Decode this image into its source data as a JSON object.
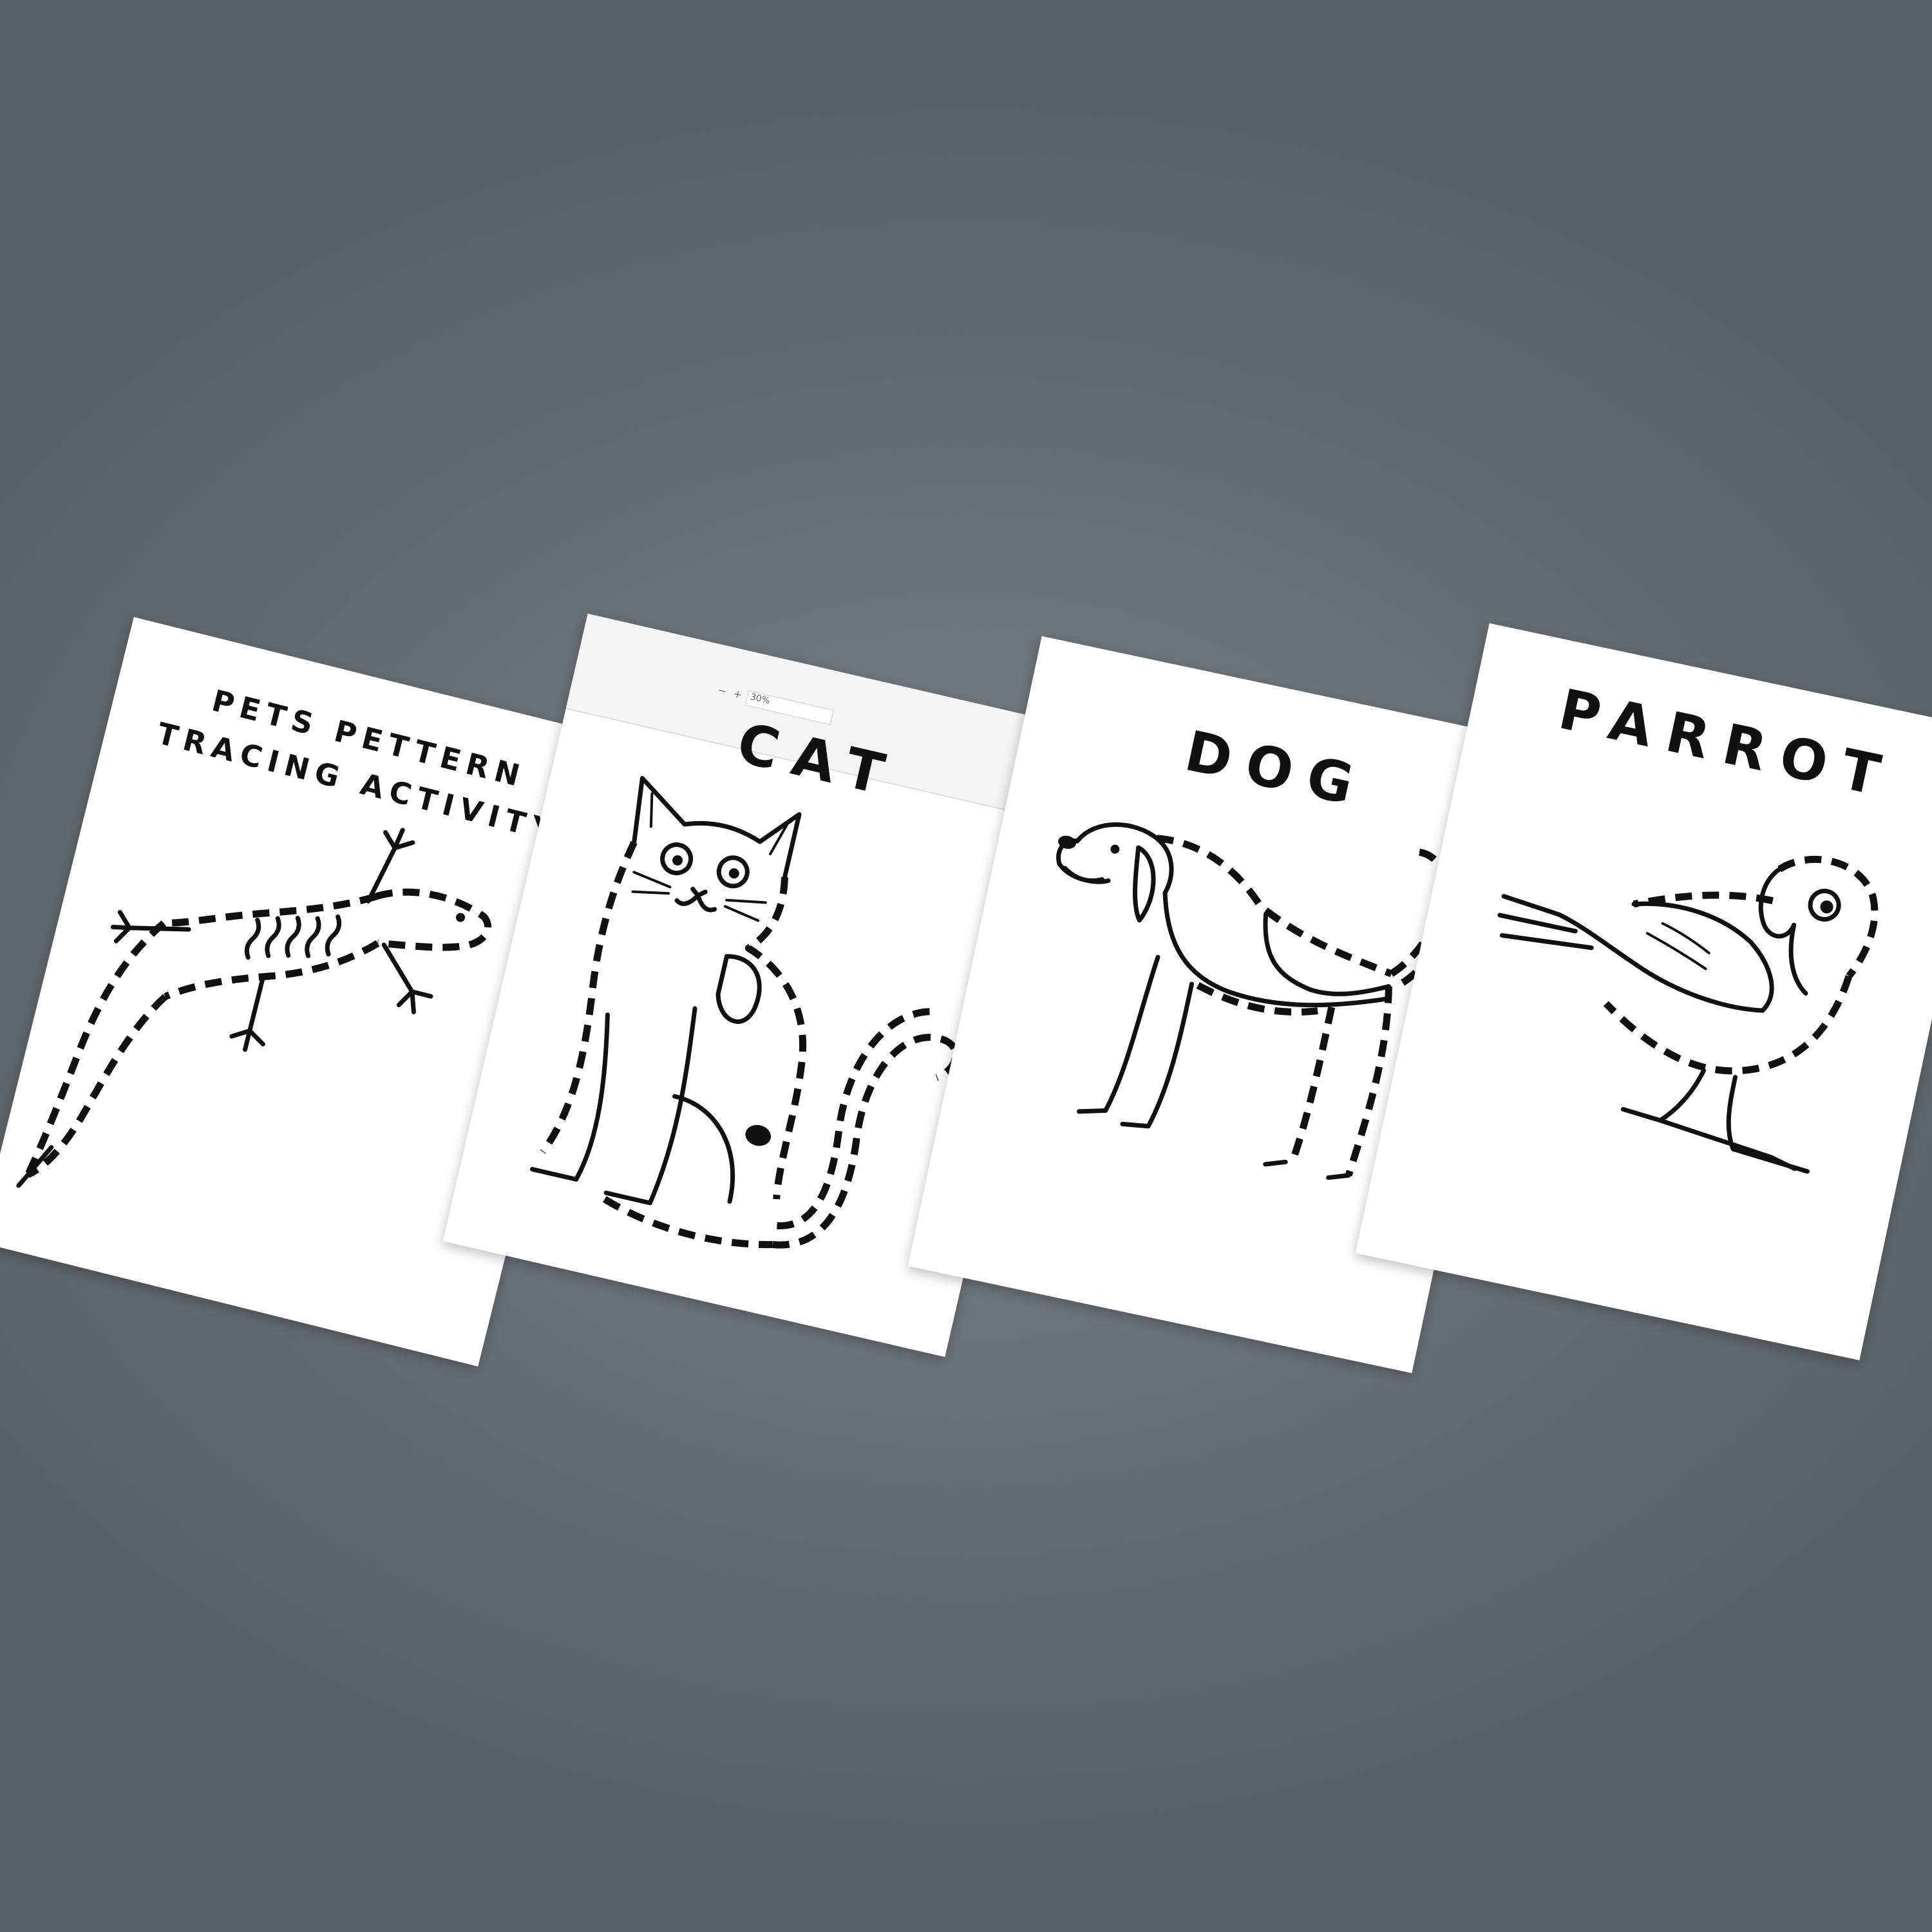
{
  "sheets": [
    {
      "title_line1": "PETS PETTERN",
      "title_line2": "TRACING ACTIVITY",
      "animal": "lizard"
    },
    {
      "title": "CAT",
      "animal": "cat"
    },
    {
      "title": "DOG",
      "animal": "dog"
    },
    {
      "title": "PARROT",
      "animal": "parrot"
    }
  ],
  "toolbar": {
    "minus": "−",
    "plus": "+",
    "zoom": "30%"
  },
  "colors": {
    "background": "#6b7278",
    "paper": "#ffffff",
    "ink": "#111111"
  }
}
